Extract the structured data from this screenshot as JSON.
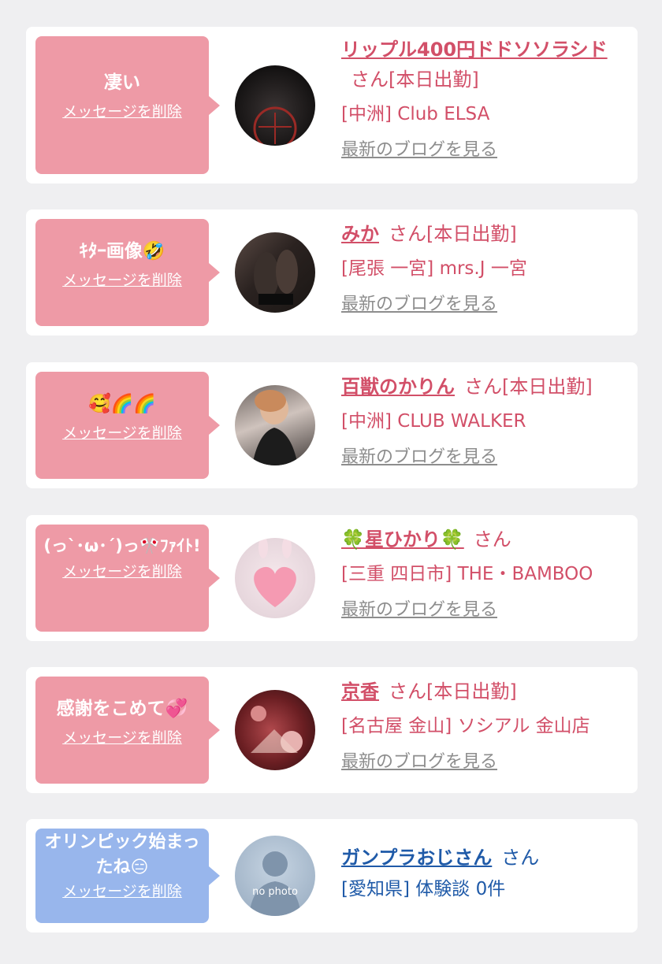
{
  "common": {
    "delete_label": "メッセージを削除",
    "blog_label": "最新のブログを見る",
    "san_suffix": "さん"
  },
  "cards": [
    {
      "message": "凄い",
      "name": "リップル400円ドドソソラシド",
      "status": "[本日出勤]",
      "shop": "[中洲] Club ELSA"
    },
    {
      "message": "ｷﾀｰ画像🤣",
      "name": "みか",
      "status": "[本日出勤]",
      "shop": "[尾張 一宮] mrs.J 一宮"
    },
    {
      "message": "🥰🌈🌈",
      "name": "百獣のかりん",
      "status": "[本日出勤]",
      "shop": "[中洲] CLUB WALKER"
    },
    {
      "message": "(っ`･ω･´)っ🎌ﾌｧｲﾄ!",
      "name": "🍀星ひかり🍀",
      "status": "",
      "shop": "[三重 四日市] THE・BAMBOO"
    },
    {
      "message": "感謝をこめて💞",
      "name": "京香",
      "status": "[本日出勤]",
      "shop": "[名古屋 金山] ソシアル 金山店"
    },
    {
      "message": "オリンピック始まったね😑",
      "name": "ガンプラおじさん",
      "status": "",
      "shop": "[愛知県] 体験談 0件",
      "no_photo_label": "no photo"
    }
  ],
  "colors": {
    "background": "#efeff1",
    "bubble_pink": "#ee9aa6",
    "bubble_blue": "#98b6ec",
    "name_pink": "#d24f68",
    "name_blue": "#1f5aa8",
    "blog_gray": "#8d8d8d"
  }
}
